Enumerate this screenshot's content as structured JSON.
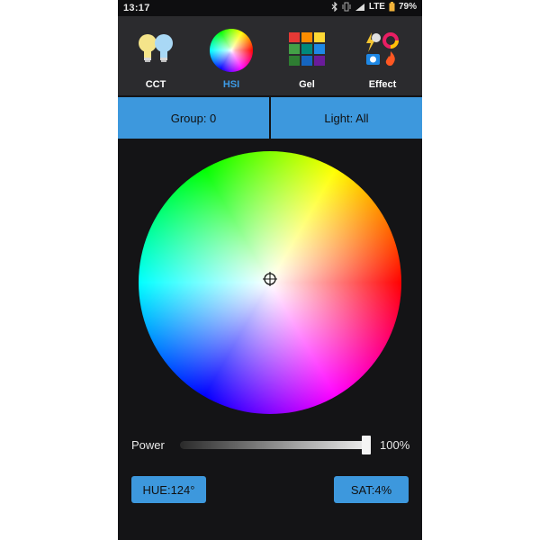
{
  "status_bar": {
    "time": "13:17",
    "network": "LTE",
    "battery": "79%",
    "icons": [
      "bluetooth-icon",
      "vibrate-icon",
      "signal-icon",
      "battery-icon"
    ]
  },
  "tabs": [
    {
      "label": "CCT",
      "icon": "bulbs-icon",
      "active": false
    },
    {
      "label": "HSI",
      "icon": "color-wheel-icon",
      "active": true
    },
    {
      "label": "Gel",
      "icon": "gel-grid-icon",
      "active": false
    },
    {
      "label": "Effect",
      "icon": "effects-icon",
      "active": false
    }
  ],
  "selectors": {
    "group": "Group: 0",
    "light": "Light: All"
  },
  "power": {
    "label": "Power",
    "value_text": "100%",
    "level_percent": 100
  },
  "hue_button": "HUE:124°",
  "sat_button": "SAT:4%",
  "colors": {
    "accent": "#3d98dd",
    "active_tab": "#3d9be6",
    "background": "#141416",
    "tab_bar": "#2b2b2e"
  }
}
